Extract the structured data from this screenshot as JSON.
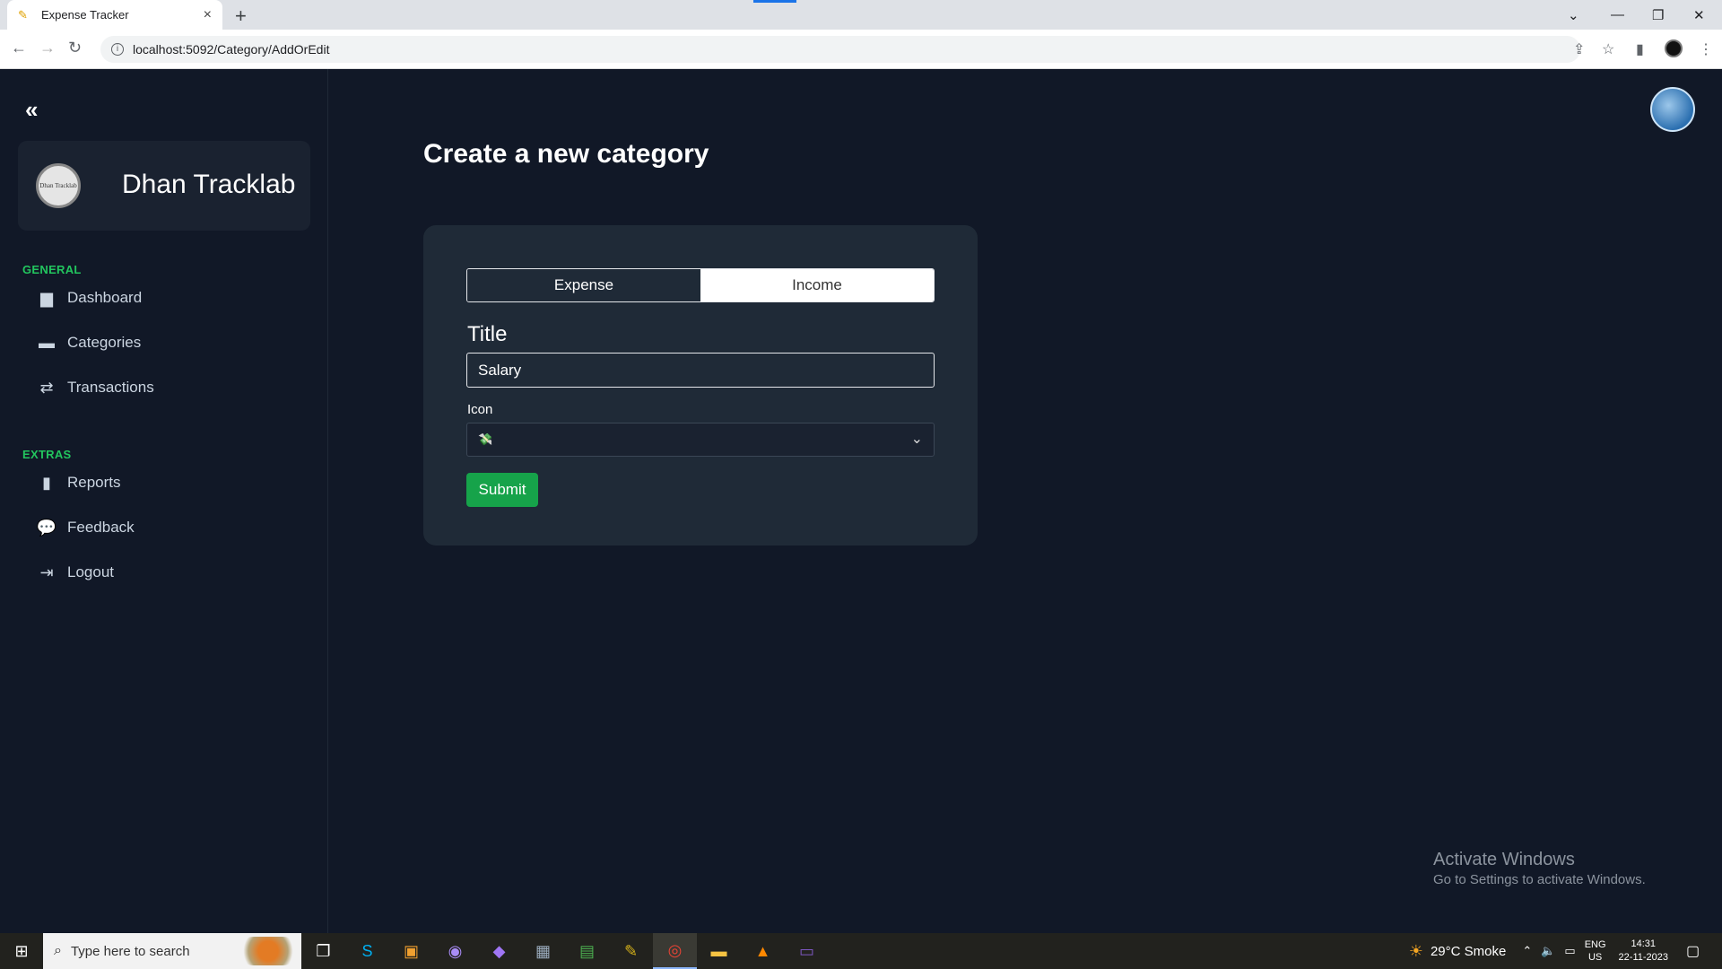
{
  "browser": {
    "tab_title": "Expense Tracker",
    "tab_close": "×",
    "new_tab": "+",
    "url": "localhost:5092/Category/AddOrEdit"
  },
  "sidebar": {
    "brand": "Dhan Tracklab",
    "logo_text": "Dhan Tracklab",
    "sections": [
      {
        "title": "GENERAL",
        "items": [
          {
            "label": "Dashboard",
            "icon": "calendar-icon"
          },
          {
            "label": "Categories",
            "icon": "folder-icon"
          },
          {
            "label": "Transactions",
            "icon": "exchange-icon"
          }
        ]
      },
      {
        "title": "EXTRAS",
        "items": [
          {
            "label": "Reports",
            "icon": "bar-chart-icon"
          },
          {
            "label": "Feedback",
            "icon": "comments-icon"
          },
          {
            "label": "Logout",
            "icon": "logout-icon"
          }
        ]
      }
    ]
  },
  "main": {
    "title": "Create a new category",
    "type_options": [
      "Expense",
      "Income"
    ],
    "selected_type": "Expense",
    "title_label": "Title",
    "title_value": "Salary",
    "icon_label": "Icon",
    "icon_value": "💸",
    "submit_label": "Submit"
  },
  "watermark": {
    "line1": "Activate Windows",
    "line2": "Go to Settings to activate Windows."
  },
  "taskbar": {
    "search_placeholder": "Type here to search",
    "weather": "29°C  Smoke",
    "lang_top": "ENG",
    "lang_bottom": "US",
    "time": "14:31",
    "date": "22-11-2023"
  },
  "colors": {
    "background": "#111827",
    "card": "#1f2a37",
    "accent_green": "#16a34a",
    "section_green": "#22c55e"
  }
}
